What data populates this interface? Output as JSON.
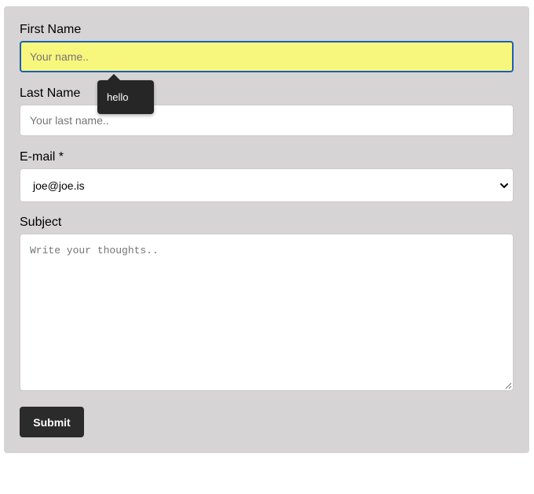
{
  "form": {
    "first_name": {
      "label": "First Name",
      "placeholder": "Your name.."
    },
    "last_name": {
      "label": "Last Name",
      "placeholder": "Your last name.."
    },
    "email": {
      "label": "E-mail *",
      "selected_value": "joe@joe.is",
      "icon": "chevron-down-icon"
    },
    "subject": {
      "label": "Subject",
      "placeholder": "Write your thoughts.."
    },
    "submit_label": "Submit"
  },
  "tooltip": {
    "text": "hello"
  },
  "colors": {
    "panel_background": "#d6d4d5",
    "focused_input_background": "#f8f77d",
    "focus_ring": "#1c5db5",
    "button_background": "#2b2b2b",
    "tooltip_background": "#262626"
  }
}
